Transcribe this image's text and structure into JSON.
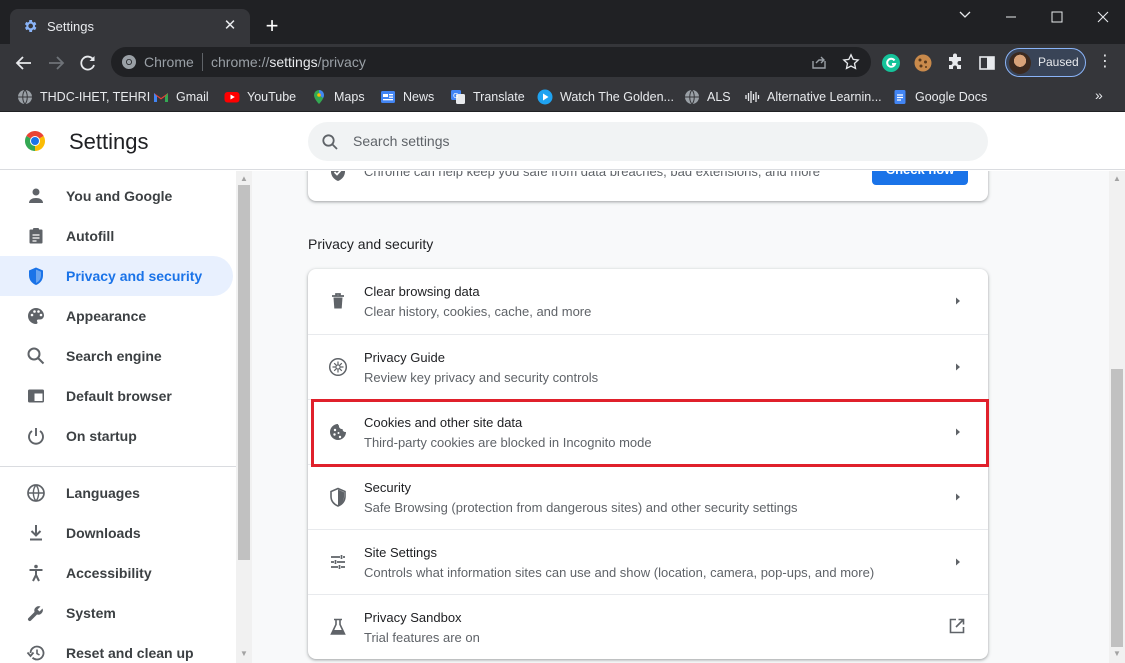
{
  "window": {
    "tab_title": "Settings",
    "tab_close_glyph": "✕",
    "new_tab_glyph": "+"
  },
  "toolbar": {
    "chip": "Chrome",
    "url_scheme": "chrome://",
    "url_host": "settings",
    "url_path": "/privacy",
    "profile_label": "Paused",
    "menu_glyph": "⋮"
  },
  "bookmarks": [
    {
      "label": "THDC-IHET, TEHRI",
      "icon": "globe-icon"
    },
    {
      "label": "Gmail",
      "icon": "gmail-icon"
    },
    {
      "label": "YouTube",
      "icon": "youtube-icon"
    },
    {
      "label": "Maps",
      "icon": "maps-icon"
    },
    {
      "label": "News",
      "icon": "news-icon"
    },
    {
      "label": "Translate",
      "icon": "translate-icon"
    },
    {
      "label": "Watch The Golden...",
      "icon": "play-icon"
    },
    {
      "label": "ALS",
      "icon": "globe-icon"
    },
    {
      "label": "Alternative Learnin...",
      "icon": "audio-icon"
    },
    {
      "label": "Google Docs",
      "icon": "docs-icon"
    }
  ],
  "bookmarks_more": "»",
  "settings": {
    "title": "Settings",
    "search_placeholder": "Search settings"
  },
  "sidebar": {
    "items": [
      {
        "label": "You and Google",
        "icon": "person-icon"
      },
      {
        "label": "Autofill",
        "icon": "assignment-icon"
      },
      {
        "label": "Privacy and security",
        "icon": "shield-icon",
        "active": true
      },
      {
        "label": "Appearance",
        "icon": "palette-icon"
      },
      {
        "label": "Search engine",
        "icon": "search-icon"
      },
      {
        "label": "Default browser",
        "icon": "browser-icon"
      },
      {
        "label": "On startup",
        "icon": "power-icon"
      },
      {
        "label": "Languages",
        "icon": "globe-icon"
      },
      {
        "label": "Downloads",
        "icon": "download-icon"
      },
      {
        "label": "Accessibility",
        "icon": "accessibility-icon"
      },
      {
        "label": "System",
        "icon": "wrench-icon"
      },
      {
        "label": "Reset and clean up",
        "icon": "restore-icon"
      }
    ]
  },
  "main": {
    "safety_check_text": "Chrome can help keep you safe from data breaches, bad extensions, and more",
    "safety_check_button": "Check now",
    "section_title": "Privacy and security",
    "rows": [
      {
        "title": "Clear browsing data",
        "subtitle": "Clear history, cookies, cache, and more",
        "icon": "trash-icon",
        "action": "chevron"
      },
      {
        "title": "Privacy Guide",
        "subtitle": "Review key privacy and security controls",
        "icon": "privacy-guide-icon",
        "action": "chevron"
      },
      {
        "title": "Cookies and other site data",
        "subtitle": "Third-party cookies are blocked in Incognito mode",
        "icon": "cookie-icon",
        "action": "chevron",
        "highlighted": true
      },
      {
        "title": "Security",
        "subtitle": "Safe Browsing (protection from dangerous sites) and other security settings",
        "icon": "shield-icon",
        "action": "chevron"
      },
      {
        "title": "Site Settings",
        "subtitle": "Controls what information sites can use and show (location, camera, pop-ups, and more)",
        "icon": "tune-icon",
        "action": "chevron"
      },
      {
        "title": "Privacy Sandbox",
        "subtitle": "Trial features are on",
        "icon": "flask-icon",
        "action": "external"
      }
    ]
  },
  "colors": {
    "accent": "#1a73e8",
    "highlight_border": "#e0202b",
    "frame_dark": "#202124",
    "frame": "#35363a"
  }
}
